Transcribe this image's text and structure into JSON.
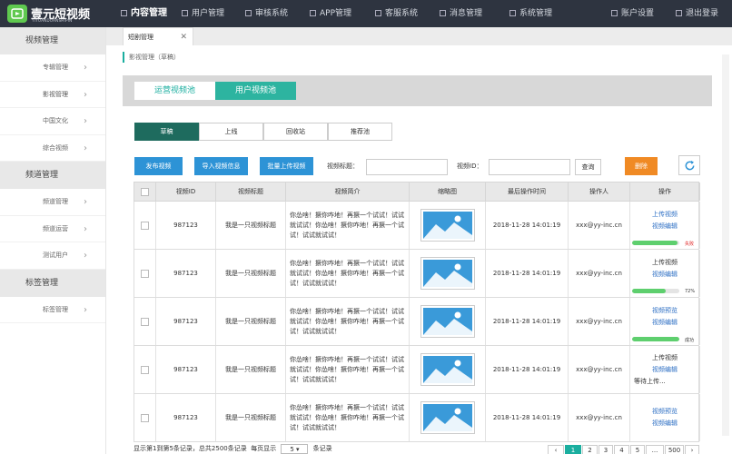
{
  "brand": {
    "name": "壹元短视频",
    "subtitle": "YIYUANDUANSHIPIN"
  },
  "nav": [
    "内容管理",
    "用户管理",
    "审核系统",
    "APP管理",
    "客服系统",
    "消息管理",
    "系统管理"
  ],
  "nav_right": [
    "账户设置",
    "退出登录"
  ],
  "sidebar": [
    {
      "group": "视频管理",
      "items": [
        "专辑管理",
        "影视管理",
        "中国文化",
        "综合视频"
      ]
    },
    {
      "group": "频道管理",
      "items": [
        "频道管理",
        "频道运营",
        "测试用户"
      ]
    },
    {
      "group": "标签管理",
      "items": [
        "标签管理"
      ]
    }
  ],
  "open_tab": "短剧管理",
  "breadcrumb": "影视管理（草稿）",
  "pool_tabs": [
    "运营视频池",
    "用户视频池"
  ],
  "status_tabs": [
    "草稿",
    "上线",
    "回收站",
    "推荐池"
  ],
  "toolbar": {
    "publish": "发布视频",
    "import": "导入视频信息",
    "bulk_upload": "批量上传视频",
    "title_label": "视频标题：",
    "id_label": "视频ID：",
    "query": "查询",
    "delete": "删除"
  },
  "columns": [
    "视频ID",
    "视频标题",
    "视频简介",
    "缩略图",
    "最后操作时间",
    "操作人",
    "操作"
  ],
  "rows": [
    {
      "id": "987123",
      "title": "我是一只视频标题",
      "desc": "你怂啥！撅你咋地！再撅一个试试！试试就试试！你怂啥！撅你咋地！再撅一个试试！试试就试试！",
      "time": "2018-11-28 14:01:19",
      "operator": "xxx@yy-inc.cn",
      "op1": "上传视频",
      "op2": "视频编辑",
      "progress": 0.97,
      "progress_text": "失败",
      "progress_color": "#e02020"
    },
    {
      "id": "987123",
      "title": "我是一只视频标题",
      "desc": "你怂啥！撅你咋地！再撅一个试试！试试就试试！你怂啥！撅你咋地！再撅一个试试！试试就试试！",
      "time": "2018-11-28 14:01:19",
      "operator": "xxx@yy-inc.cn",
      "op1": "上传视频",
      "op2": "视频编辑",
      "progress": 0.72,
      "progress_text": "72%",
      "progress_color": "#333333"
    },
    {
      "id": "987123",
      "title": "我是一只视频标题",
      "desc": "你怂啥！撅你咋地！再撅一个试试！试试就试试！你怂啥！撅你咋地！再撅一个试试！试试就试试！",
      "time": "2018-11-28 14:01:19",
      "operator": "xxx@yy-inc.cn",
      "op1": "视频预览",
      "op2": "视频编辑",
      "progress": 1.0,
      "progress_text": "成功",
      "progress_color": "#333333"
    },
    {
      "id": "987123",
      "title": "我是一只视频标题",
      "desc": "你怂啥！撅你咋地！再撅一个试试！试试就试试！你怂啥！撅你咋地！再撅一个试试！试试就试试！",
      "time": "2018-11-28 14:01:19",
      "operator": "xxx@yy-inc.cn",
      "op1": "上传视频",
      "op2": "视频编辑",
      "op3": "等待上传..."
    },
    {
      "id": "987123",
      "title": "我是一只视频标题",
      "desc": "你怂啥！撅你咋地！再撅一个试试！试试就试试！你怂啥！撅你咋地！再撅一个试试！试试就试试！",
      "time": "2018-11-28 14:01:19",
      "operator": "xxx@yy-inc.cn",
      "op1": "视频预览",
      "op2": "视频编辑"
    }
  ],
  "footer": {
    "text1": "显示第1到第5条记录，总共2500条记录",
    "text2": "每页显示",
    "page_size": "5",
    "text3": "条记录"
  },
  "pagination": [
    "‹",
    "1",
    "2",
    "3",
    "4",
    "5",
    "...",
    "500",
    "›"
  ]
}
